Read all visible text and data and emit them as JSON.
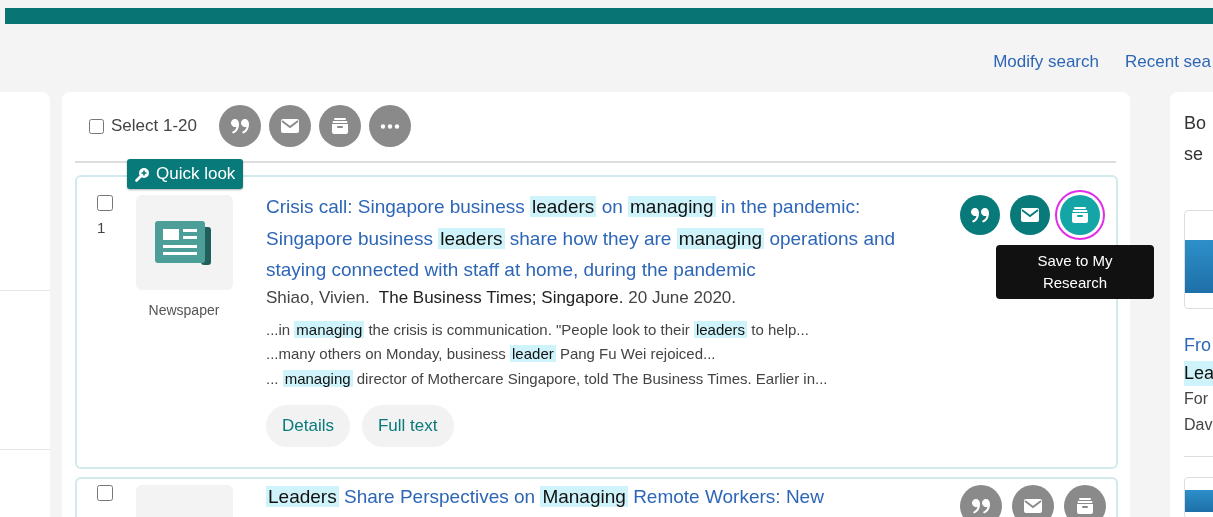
{
  "header_links": [
    "Modify search",
    "Recent sea"
  ],
  "toolbar": {
    "select_label": "Select 1-20",
    "select_checked": false
  },
  "results": [
    {
      "number": "1",
      "checked": false,
      "quick_look": "Quick look",
      "type_label": "Newspaper",
      "title": [
        {
          "text": "Crisis call: Singapore business",
          "highlight": false
        },
        {
          "text": "leaders",
          "highlight": true
        },
        {
          "text": "on",
          "highlight": false
        },
        {
          "text": "managing",
          "highlight": true
        },
        {
          "text": "in the pandemic: Singapore business",
          "highlight": false
        },
        {
          "text": "leaders",
          "highlight": true
        },
        {
          "text": "share how they are",
          "highlight": false
        },
        {
          "text": "managing",
          "highlight": true
        },
        {
          "text": "operations and staying connected with staff at home, during the pandemic",
          "highlight": false
        }
      ],
      "author": "Shiao, Vivien.",
      "source": "The Business Times; Singapore.",
      "date": "20 June 2020.",
      "snippets": [
        [
          {
            "text": "...in",
            "highlight": false
          },
          {
            "text": "managing",
            "highlight": true
          },
          {
            "text": "the crisis is communication. \"People look to their",
            "highlight": false
          },
          {
            "text": "leaders",
            "highlight": true
          },
          {
            "text": "to help...",
            "highlight": false
          }
        ],
        [
          {
            "text": "...many others on Monday, business",
            "highlight": false
          },
          {
            "text": "leader",
            "highlight": true
          },
          {
            "text": "Pang Fu Wei rejoiced...",
            "highlight": false
          }
        ],
        [
          {
            "text": "...",
            "highlight": false
          },
          {
            "text": "managing",
            "highlight": true
          },
          {
            "text": "director of Mothercare Singapore, told The Business Times. Earlier in...",
            "highlight": false
          }
        ]
      ],
      "buttons": [
        "Details",
        "Full text"
      ],
      "save_focused": true,
      "tooltip": "Save to My Research"
    },
    {
      "checked": false,
      "title": [
        {
          "text": "Leaders",
          "highlight": true
        },
        {
          "text": "Share Perspectives on",
          "highlight": false
        },
        {
          "text": "Managing",
          "highlight": true
        },
        {
          "text": "Remote Workers: New",
          "highlight": false
        }
      ]
    }
  ],
  "sidebar": {
    "heading_lines": [
      "Bo",
      "se"
    ],
    "item_title": "Fro",
    "item_highlight": "Lea",
    "item_lines": [
      "For",
      "Dav"
    ]
  }
}
